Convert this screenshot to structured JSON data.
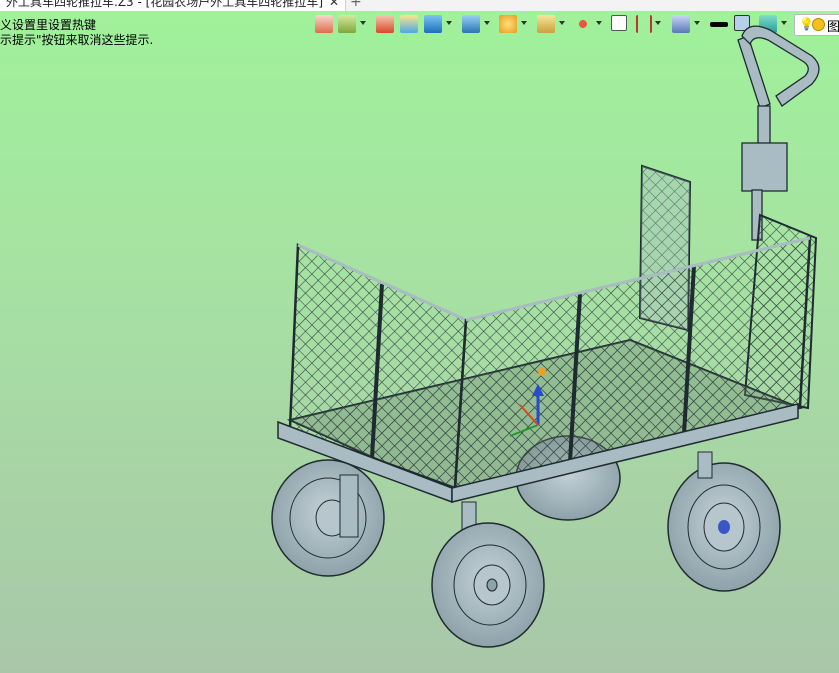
{
  "tab": {
    "title": "外工具车四轮推拉车.Z3 - [花园农场户外工具车四轮推拉车]",
    "close": "✕"
  },
  "new_tab": "+",
  "hints": [
    "义设置里设置热键",
    "示提示\"按钮来取消这些提示."
  ],
  "search": {
    "label": "图"
  },
  "colors": {
    "viewport_top": "#9ff29a",
    "viewport_bottom": "#a9c7a8",
    "model": "#a9bcc3",
    "outline": "#1f2b30"
  },
  "toolbar_icons": [
    "exit-icon",
    "layers-icon",
    "brush-icon",
    "box-icon",
    "cube-icon",
    "view-cube-icon",
    "explode-icon",
    "render-icon",
    "pivot-icon",
    "frame-icon",
    "align-icon",
    "display-icon",
    "line-color-icon",
    "fill-color-icon",
    "material-icon"
  ]
}
